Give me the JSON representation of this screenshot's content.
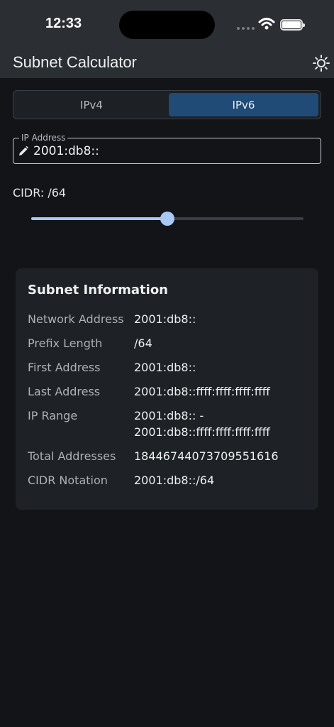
{
  "status_bar": {
    "time": "12:33"
  },
  "app_bar": {
    "title": "Subnet Calculator",
    "theme_icon": "sun-icon"
  },
  "tabs": [
    {
      "label": "IPv4",
      "selected": false
    },
    {
      "label": "IPv6",
      "selected": true
    }
  ],
  "ip_field": {
    "label": "IP Address",
    "value": "2001:db8::",
    "icon": "pencil-icon"
  },
  "cidr": {
    "label": "CIDR: /64",
    "value": 64,
    "min": 0,
    "max": 128
  },
  "subnet_info": {
    "title": "Subnet Information",
    "rows": [
      {
        "key": "Network Address",
        "value": "2001:db8::"
      },
      {
        "key": "Prefix Length",
        "value": "/64"
      },
      {
        "key": "First Address",
        "value": "2001:db8::"
      },
      {
        "key": "Last Address",
        "value": "2001:db8::ffff:ffff:ffff:ffff"
      },
      {
        "key": "IP Range",
        "value": "2001:db8:: -\n2001:db8::ffff:ffff:ffff:ffff"
      },
      {
        "key": "Total Addresses",
        "value": "18446744073709551616"
      },
      {
        "key": "CIDR Notation",
        "value": "2001:db8::/64"
      }
    ]
  },
  "colors": {
    "accent": "#a9c8f5",
    "selected_tab": "#1f4b76",
    "background": "#121418",
    "card": "#1e2125"
  }
}
